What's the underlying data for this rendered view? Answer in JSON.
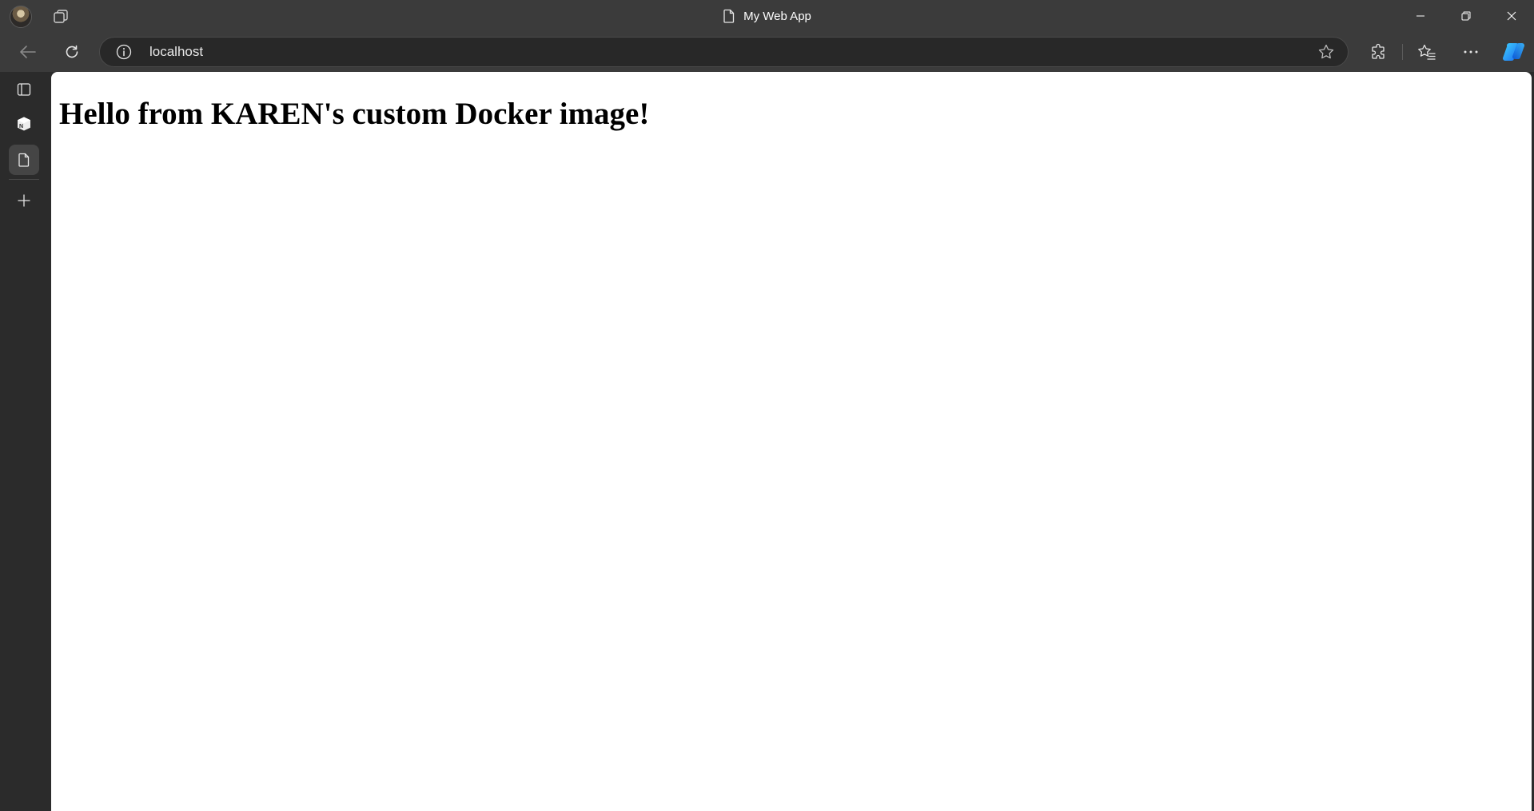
{
  "window": {
    "title": "My Web App"
  },
  "toolbar": {
    "url": "localhost"
  },
  "page": {
    "heading": "Hello from KAREN's custom Docker image!"
  }
}
